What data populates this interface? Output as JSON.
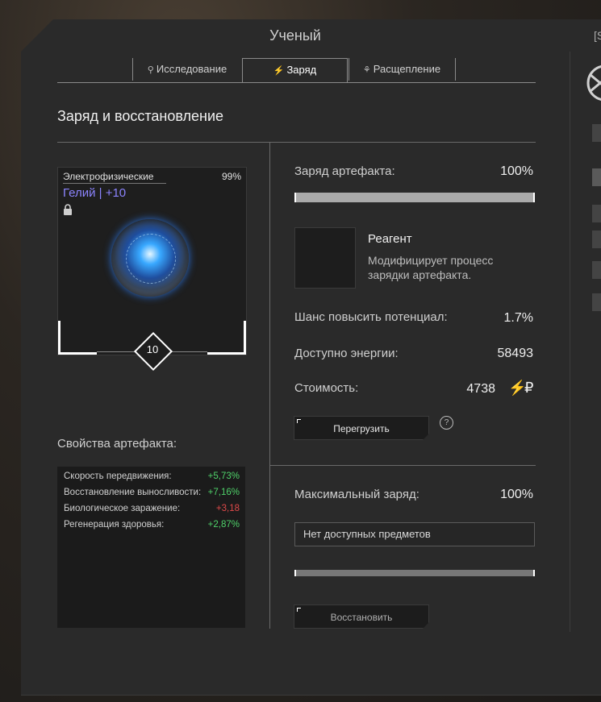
{
  "window": {
    "title": "Ученый",
    "hotkey": "[S"
  },
  "tabs": [
    {
      "icon": "search-icon",
      "glyph": "⚲",
      "label": "Исследование"
    },
    {
      "icon": "lightning-icon",
      "glyph": "⚡",
      "label": "Заряд",
      "active": true
    },
    {
      "icon": "split-icon",
      "glyph": "⚘",
      "label": "Расщепление"
    }
  ],
  "section_title": "Заряд и восстановление",
  "artifact": {
    "type": "Электрофизические",
    "percent": "99%",
    "name": "Гелий | +10",
    "level": "10",
    "name_color": "#8c84ff"
  },
  "properties": {
    "title": "Свойства артефакта:",
    "items": [
      {
        "name": "Скорость передвижения:",
        "value": "+5,73%",
        "sign": "pos"
      },
      {
        "name": "Восстановление выносливости:",
        "value": "+7,16%",
        "sign": "pos"
      },
      {
        "name": "Биологическое заражение:",
        "value": "+3,18",
        "sign": "neg"
      },
      {
        "name": "Регенерация здоровья:",
        "value": "+2,87%",
        "sign": "pos"
      }
    ]
  },
  "charge": {
    "label": "Заряд артефакта:",
    "value": "100%",
    "fill_fraction": 1.0
  },
  "reagent": {
    "title": "Реагент",
    "description": "Модифицирует процесс зарядки артефакта."
  },
  "stats": {
    "chance_label": "Шанс повысить потенциал:",
    "chance_value": "1.7%",
    "energy_label": "Доступно энергии:",
    "energy_value": "58493",
    "cost_label": "Стоимость:",
    "cost_value": "4738",
    "cost_icons": {
      "lightning": "⚡",
      "ruble": "₽"
    }
  },
  "overload_button": "Перегрузить",
  "help_glyph": "?",
  "max_charge": {
    "label": "Максимальный заряд:",
    "value": "100%",
    "fill_fraction": 1.0
  },
  "item_select": {
    "value": "Нет доступных предметов"
  },
  "restore_button": "Восстановить",
  "colors": {
    "positive": "#4fd26a",
    "negative": "#e04a4a",
    "accent_name": "#8c84ff"
  }
}
